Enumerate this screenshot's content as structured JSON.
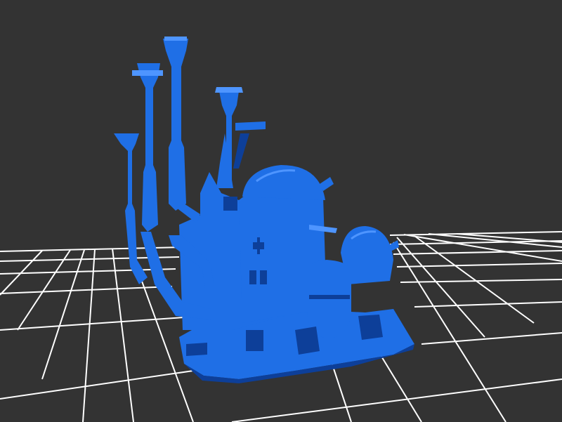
{
  "viewport": {
    "name": "3d-model-viewport",
    "background_color": "#333333",
    "grid_color": "#ffffff",
    "model_color": "#1f6fe6",
    "model_shadow_color": "#0d3f99",
    "model_highlight_color": "#4e95ff",
    "model_label": "castle-model"
  }
}
